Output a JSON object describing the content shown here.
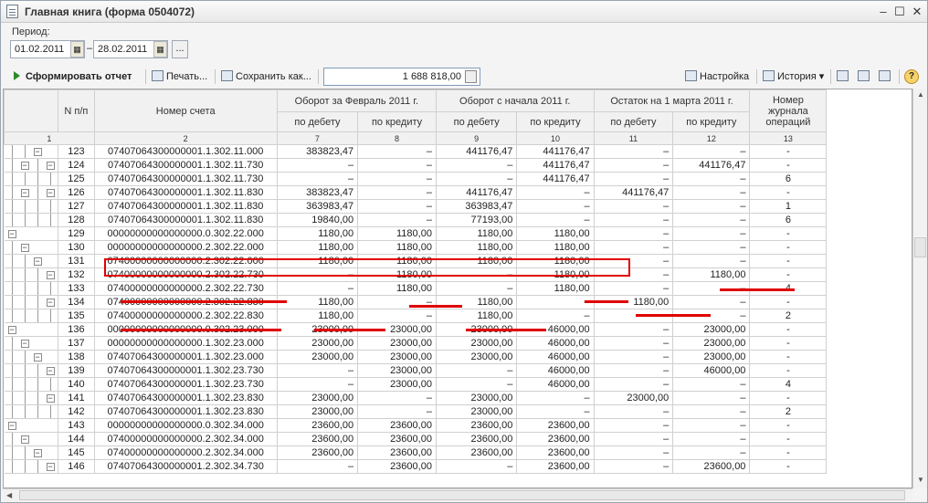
{
  "window": {
    "title": "Главная книга (форма 0504072)",
    "minimize": "–",
    "maximize": "☐",
    "close": "✕"
  },
  "period": {
    "label": "Период:",
    "from": "01.02.2011",
    "to": "28.02.2011",
    "dash": "–",
    "more": "..."
  },
  "toolbar": {
    "generate": "Сформировать отчет",
    "print": "Печать...",
    "save": "Сохранить как...",
    "sum": "1 688 818,00",
    "settings": "Настройка",
    "history": "История",
    "help": "?"
  },
  "headers": {
    "n": "N п/п",
    "account": "Номер счета",
    "turnover_month": "Оборот за Февраль 2011 г.",
    "turnover_year": "Оборот с начала 2011 г.",
    "balance": "Остаток на 1 марта 2011 г.",
    "debit": "по дебету",
    "credit": "по кредиту",
    "journal": "Номер журнала операций",
    "nums": [
      "1",
      "2",
      "7",
      "8",
      "9",
      "10",
      "11",
      "12",
      "13"
    ]
  },
  "rows": [
    {
      "n": "123",
      "acc": "07407064300000001.1.302.11.000",
      "v": [
        "383823,47",
        "–",
        "441176,47",
        "441176,47",
        "–",
        "–",
        "-"
      ]
    },
    {
      "n": "124",
      "acc": "07407064300000001.1.302.11.730",
      "v": [
        "–",
        "–",
        "–",
        "441176,47",
        "–",
        "441176,47",
        "-"
      ]
    },
    {
      "n": "125",
      "acc": "07407064300000001.1.302.11.730",
      "v": [
        "–",
        "–",
        "–",
        "441176,47",
        "–",
        "–",
        "6"
      ]
    },
    {
      "n": "126",
      "acc": "07407064300000001.1.302.11.830",
      "v": [
        "383823,47",
        "–",
        "441176,47",
        "–",
        "441176,47",
        "–",
        "-"
      ]
    },
    {
      "n": "127",
      "acc": "07407064300000001.1.302.11.830",
      "v": [
        "363983,47",
        "–",
        "363983,47",
        "–",
        "–",
        "–",
        "1"
      ]
    },
    {
      "n": "128",
      "acc": "07407064300000001.1.302.11.830",
      "v": [
        "19840,00",
        "–",
        "77193,00",
        "–",
        "–",
        "–",
        "6"
      ]
    },
    {
      "n": "129",
      "acc": "00000000000000000.0.302.22.000",
      "v": [
        "1180,00",
        "1180,00",
        "1180,00",
        "1180,00",
        "–",
        "–",
        "-"
      ]
    },
    {
      "n": "130",
      "acc": "00000000000000000.2.302.22.000",
      "v": [
        "1180,00",
        "1180,00",
        "1180,00",
        "1180,00",
        "–",
        "–",
        "-"
      ]
    },
    {
      "n": "131",
      "acc": "07400000000000000.2.302.22.000",
      "v": [
        "1180,00",
        "1180,00",
        "1180,00",
        "1180,00",
        "–",
        "–",
        "-"
      ]
    },
    {
      "n": "132",
      "acc": "07400000000000000.2.302.22.730",
      "v": [
        "–",
        "1180,00",
        "–",
        "1180,00",
        "–",
        "1180,00",
        "-"
      ]
    },
    {
      "n": "133",
      "acc": "07400000000000000.2.302.22.730",
      "v": [
        "–",
        "1180,00",
        "–",
        "1180,00",
        "–",
        "–",
        "4"
      ]
    },
    {
      "n": "134",
      "acc": "07400000000000000.2.302.22.830",
      "v": [
        "1180,00",
        "–",
        "1180,00",
        "–",
        "1180,00",
        "–",
        "-"
      ]
    },
    {
      "n": "135",
      "acc": "07400000000000000.2.302.22.830",
      "v": [
        "1180,00",
        "–",
        "1180,00",
        "–",
        "–",
        "–",
        "2"
      ]
    },
    {
      "n": "136",
      "acc": "00000000000000000.0.302.23.000",
      "v": [
        "23000,00",
        "23000,00",
        "23000,00",
        "46000,00",
        "–",
        "23000,00",
        "-"
      ]
    },
    {
      "n": "137",
      "acc": "00000000000000000.1.302.23.000",
      "v": [
        "23000,00",
        "23000,00",
        "23000,00",
        "46000,00",
        "–",
        "23000,00",
        "-"
      ]
    },
    {
      "n": "138",
      "acc": "07407064300000001.1.302.23.000",
      "v": [
        "23000,00",
        "23000,00",
        "23000,00",
        "46000,00",
        "–",
        "23000,00",
        "-"
      ]
    },
    {
      "n": "139",
      "acc": "07407064300000001.1.302.23.730",
      "v": [
        "–",
        "23000,00",
        "–",
        "46000,00",
        "–",
        "46000,00",
        "-"
      ]
    },
    {
      "n": "140",
      "acc": "07407064300000001.1.302.23.730",
      "v": [
        "–",
        "23000,00",
        "–",
        "46000,00",
        "–",
        "–",
        "4"
      ]
    },
    {
      "n": "141",
      "acc": "07407064300000001.1.302.23.830",
      "v": [
        "23000,00",
        "–",
        "23000,00",
        "–",
        "23000,00",
        "–",
        "-"
      ]
    },
    {
      "n": "142",
      "acc": "07407064300000001.1.302.23.830",
      "v": [
        "23000,00",
        "–",
        "23000,00",
        "–",
        "–",
        "–",
        "2"
      ]
    },
    {
      "n": "143",
      "acc": "00000000000000000.0.302.34.000",
      "v": [
        "23600,00",
        "23600,00",
        "23600,00",
        "23600,00",
        "–",
        "–",
        "-"
      ]
    },
    {
      "n": "144",
      "acc": "07400000000000000.2.302.34.000",
      "v": [
        "23600,00",
        "23600,00",
        "23600,00",
        "23600,00",
        "–",
        "–",
        "-"
      ]
    },
    {
      "n": "145",
      "acc": "07400000000000000.2.302.34.000",
      "v": [
        "23600,00",
        "23600,00",
        "23600,00",
        "23600,00",
        "–",
        "–",
        "-"
      ]
    },
    {
      "n": "146",
      "acc": "07407064300000001.2.302.34.730",
      "v": [
        "–",
        "23600,00",
        "–",
        "23600,00",
        "–",
        "23600,00",
        "-"
      ]
    }
  ],
  "tree": [
    [
      "v",
      "v",
      "b"
    ],
    [
      "v",
      "b",
      "v",
      "b"
    ],
    [
      "v",
      "v",
      "v",
      "v"
    ],
    [
      "v",
      "b",
      "v",
      "b"
    ],
    [
      "v",
      "v",
      "v",
      "v"
    ],
    [
      "v",
      "v",
      "v",
      "v"
    ],
    [
      "b"
    ],
    [
      "v",
      "b"
    ],
    [
      "v",
      "v",
      "b"
    ],
    [
      "v",
      "v",
      "v",
      "b"
    ],
    [
      "v",
      "v",
      "v",
      "v"
    ],
    [
      "v",
      "v",
      "v",
      "b"
    ],
    [
      "v",
      "v",
      "v",
      "v"
    ],
    [
      "b"
    ],
    [
      "v",
      "b"
    ],
    [
      "v",
      "v",
      "b"
    ],
    [
      "v",
      "v",
      "v",
      "b"
    ],
    [
      "v",
      "v",
      "v",
      "v"
    ],
    [
      "v",
      "v",
      "v",
      "b"
    ],
    [
      "v",
      "v",
      "v",
      "v"
    ],
    [
      "b"
    ],
    [
      "v",
      "b"
    ],
    [
      "v",
      "v",
      "b"
    ],
    [
      "v",
      "v",
      "v",
      "b"
    ]
  ]
}
